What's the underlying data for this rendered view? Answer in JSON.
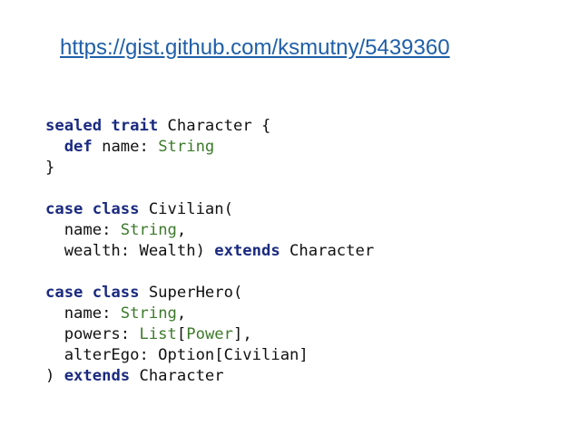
{
  "slide": {
    "link": "https://gist.github.com/ksmutny/5439360",
    "colors": {
      "link": "#1f5fa8",
      "keyword": "#1a2a80",
      "type": "#3c7a2a",
      "text": "#111111"
    },
    "code_lines": [
      [
        {
          "t": "sealed trait",
          "k": "kw"
        },
        {
          "t": " Character {",
          "k": "pl"
        }
      ],
      [
        {
          "t": "  ",
          "k": "pl"
        },
        {
          "t": "def",
          "k": "kw"
        },
        {
          "t": " name: ",
          "k": "pl"
        },
        {
          "t": "String",
          "k": "ty"
        }
      ],
      [
        {
          "t": "}",
          "k": "pl"
        }
      ],
      [],
      [
        {
          "t": "case class",
          "k": "kw"
        },
        {
          "t": " Civilian(",
          "k": "pl"
        }
      ],
      [
        {
          "t": "  name: ",
          "k": "pl"
        },
        {
          "t": "String",
          "k": "ty"
        },
        {
          "t": ",",
          "k": "pl"
        }
      ],
      [
        {
          "t": "  wealth: Wealth) ",
          "k": "pl"
        },
        {
          "t": "extends",
          "k": "kw"
        },
        {
          "t": " Character",
          "k": "pl"
        }
      ],
      [],
      [
        {
          "t": "case class",
          "k": "kw"
        },
        {
          "t": " SuperHero(",
          "k": "pl"
        }
      ],
      [
        {
          "t": "  name: ",
          "k": "pl"
        },
        {
          "t": "String",
          "k": "ty"
        },
        {
          "t": ",",
          "k": "pl"
        }
      ],
      [
        {
          "t": "  powers: ",
          "k": "pl"
        },
        {
          "t": "List",
          "k": "ty"
        },
        {
          "t": "[",
          "k": "pl"
        },
        {
          "t": "Power",
          "k": "ty"
        },
        {
          "t": "],",
          "k": "pl"
        }
      ],
      [
        {
          "t": "  alterEgo: Option[Civilian]",
          "k": "pl"
        }
      ],
      [
        {
          "t": ") ",
          "k": "pl"
        },
        {
          "t": "extends",
          "k": "kw"
        },
        {
          "t": " Character",
          "k": "pl"
        }
      ]
    ]
  }
}
